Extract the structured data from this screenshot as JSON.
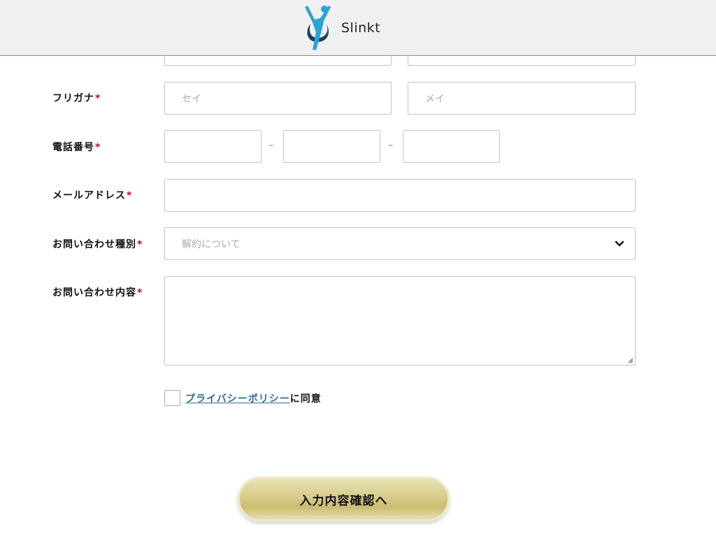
{
  "header": {
    "brand_name": "Slinkt",
    "logo_icon": "jumping-person-logo-icon"
  },
  "form": {
    "required_mark": "*",
    "furigana": {
      "label": "フリガナ",
      "sei_placeholder": "セイ",
      "mei_placeholder": "メイ"
    },
    "phone": {
      "label": "電話番号",
      "separator": "–"
    },
    "email": {
      "label": "メールアドレス"
    },
    "inquiry_type": {
      "label": "お問い合わせ種別",
      "selected": "解約について",
      "icon": "chevron-down-icon"
    },
    "inquiry_content": {
      "label": "お問い合わせ内容"
    },
    "privacy": {
      "link_text": "プライバシーポリシー",
      "suffix_text": "に同意"
    },
    "submit_label": "入力内容確認へ"
  },
  "colors": {
    "required": "#d0021b",
    "link": "#2a6f8f",
    "button_gold": "#d7cc8a",
    "logo_blue": "#2aa3d6",
    "logo_navy": "#1c3f63"
  }
}
